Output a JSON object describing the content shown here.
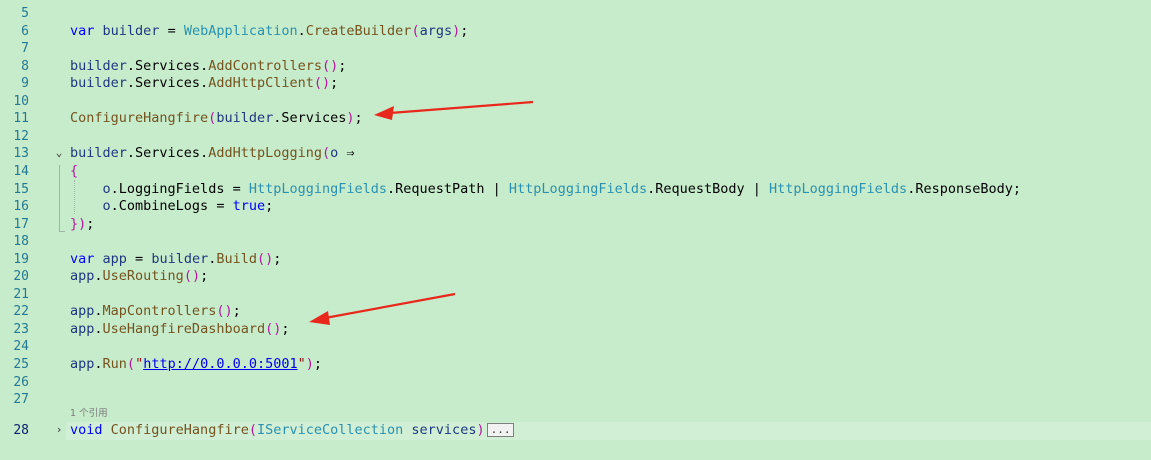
{
  "editor": {
    "background": "#c7eccb",
    "arrow_color": "#e8281c",
    "codelens_text": "1 个引用",
    "collapsed_label": "...",
    "lines": [
      {
        "num": "5",
        "tokens": []
      },
      {
        "num": "6",
        "tokens": [
          [
            "kw",
            "var"
          ],
          [
            "plain",
            " "
          ],
          [
            "ident",
            "builder"
          ],
          [
            "plain",
            " = "
          ],
          [
            "type",
            "WebApplication"
          ],
          [
            "plain",
            "."
          ],
          [
            "method",
            "CreateBuilder"
          ],
          [
            "bracket",
            "("
          ],
          [
            "ident",
            "args"
          ],
          [
            "bracket",
            ")"
          ],
          [
            "plain",
            ";"
          ]
        ]
      },
      {
        "num": "7",
        "tokens": []
      },
      {
        "num": "8",
        "tokens": [
          [
            "ident",
            "builder"
          ],
          [
            "plain",
            ".Services."
          ],
          [
            "method",
            "AddControllers"
          ],
          [
            "bracket",
            "()"
          ],
          [
            "plain",
            ";"
          ]
        ]
      },
      {
        "num": "9",
        "tokens": [
          [
            "ident",
            "builder"
          ],
          [
            "plain",
            ".Services."
          ],
          [
            "method",
            "AddHttpClient"
          ],
          [
            "bracket",
            "()"
          ],
          [
            "plain",
            ";"
          ]
        ]
      },
      {
        "num": "10",
        "tokens": []
      },
      {
        "num": "11",
        "tokens": [
          [
            "method",
            "ConfigureHangfire"
          ],
          [
            "bracket",
            "("
          ],
          [
            "ident",
            "builder"
          ],
          [
            "plain",
            ".Services"
          ],
          [
            "bracket",
            ")"
          ],
          [
            "plain",
            ";"
          ]
        ]
      },
      {
        "num": "12",
        "tokens": []
      },
      {
        "num": "13",
        "tokens": [
          [
            "ident",
            "builder"
          ],
          [
            "plain",
            ".Services."
          ],
          [
            "method",
            "AddHttpLogging"
          ],
          [
            "bracket",
            "("
          ],
          [
            "ident",
            "o"
          ],
          [
            "plain",
            " ⇒"
          ]
        ]
      },
      {
        "num": "14",
        "tokens": [
          [
            "brace",
            "{"
          ]
        ]
      },
      {
        "num": "15",
        "tokens": [
          [
            "plain",
            "    "
          ],
          [
            "ident",
            "o"
          ],
          [
            "plain",
            ".LoggingFields = "
          ],
          [
            "type",
            "HttpLoggingFields"
          ],
          [
            "plain",
            ".RequestPath | "
          ],
          [
            "type",
            "HttpLoggingFields"
          ],
          [
            "plain",
            ".RequestBody | "
          ],
          [
            "type",
            "HttpLoggingFields"
          ],
          [
            "plain",
            ".ResponseBody;"
          ]
        ]
      },
      {
        "num": "16",
        "tokens": [
          [
            "plain",
            "    "
          ],
          [
            "ident",
            "o"
          ],
          [
            "plain",
            ".CombineLogs = "
          ],
          [
            "kw",
            "true"
          ],
          [
            "plain",
            ";"
          ]
        ]
      },
      {
        "num": "17",
        "tokens": [
          [
            "brace",
            "}"
          ],
          [
            "bracket",
            ")"
          ],
          [
            "plain",
            ";"
          ]
        ]
      },
      {
        "num": "18",
        "tokens": []
      },
      {
        "num": "19",
        "tokens": [
          [
            "kw",
            "var"
          ],
          [
            "plain",
            " "
          ],
          [
            "ident",
            "app"
          ],
          [
            "plain",
            " = "
          ],
          [
            "ident",
            "builder"
          ],
          [
            "plain",
            "."
          ],
          [
            "method",
            "Build"
          ],
          [
            "bracket",
            "()"
          ],
          [
            "plain",
            ";"
          ]
        ]
      },
      {
        "num": "20",
        "tokens": [
          [
            "ident",
            "app"
          ],
          [
            "plain",
            "."
          ],
          [
            "method",
            "UseRouting"
          ],
          [
            "bracket",
            "()"
          ],
          [
            "plain",
            ";"
          ]
        ]
      },
      {
        "num": "21",
        "tokens": []
      },
      {
        "num": "22",
        "tokens": [
          [
            "ident",
            "app"
          ],
          [
            "plain",
            "."
          ],
          [
            "method",
            "MapControllers"
          ],
          [
            "bracket",
            "()"
          ],
          [
            "plain",
            ";"
          ]
        ]
      },
      {
        "num": "23",
        "tokens": [
          [
            "ident",
            "app"
          ],
          [
            "plain",
            "."
          ],
          [
            "method",
            "UseHangfireDashboard"
          ],
          [
            "bracket",
            "()"
          ],
          [
            "plain",
            ";"
          ]
        ]
      },
      {
        "num": "24",
        "tokens": []
      },
      {
        "num": "25",
        "tokens": [
          [
            "ident",
            "app"
          ],
          [
            "plain",
            "."
          ],
          [
            "method",
            "Run"
          ],
          [
            "bracket",
            "("
          ],
          [
            "string",
            "\""
          ],
          [
            "link",
            "http://0.0.0.0:5001"
          ],
          [
            "string",
            "\""
          ],
          [
            "bracket",
            ")"
          ],
          [
            "plain",
            ";"
          ]
        ]
      },
      {
        "num": "26",
        "tokens": []
      },
      {
        "num": "27",
        "tokens": []
      },
      {
        "num": "28",
        "tokens": [
          [
            "kw",
            "void"
          ],
          [
            "plain",
            " "
          ],
          [
            "method",
            "ConfigureHangfire"
          ],
          [
            "bracket",
            "("
          ],
          [
            "type",
            "IServiceCollection"
          ],
          [
            "plain",
            " "
          ],
          [
            "ident",
            "services"
          ],
          [
            "bracket",
            ")"
          ]
        ]
      }
    ]
  }
}
